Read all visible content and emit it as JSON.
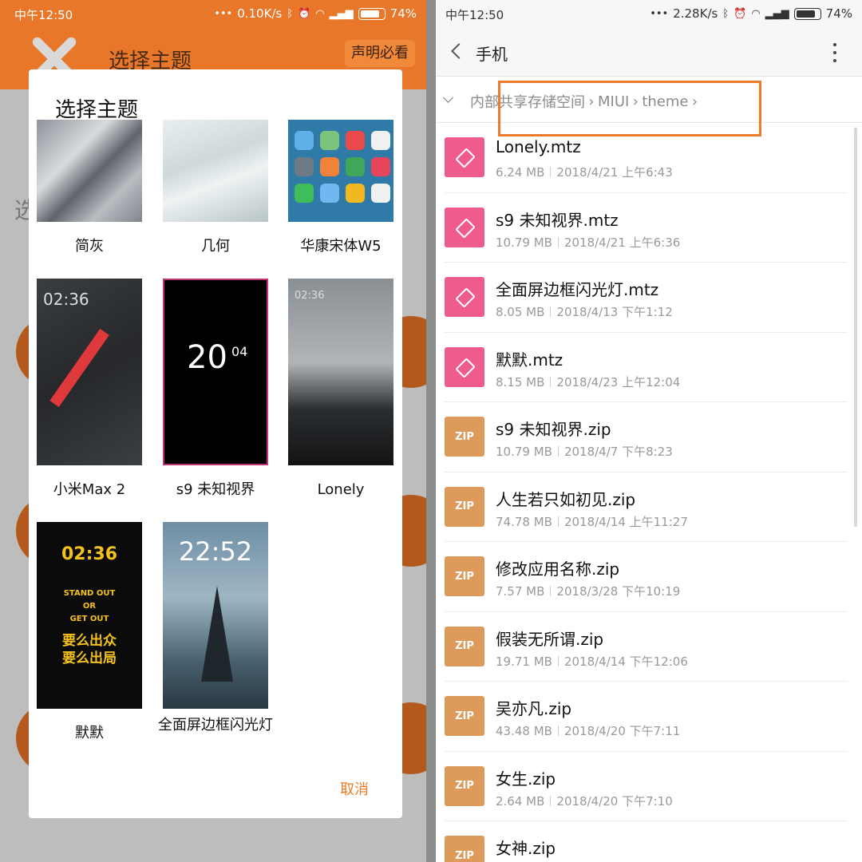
{
  "left": {
    "status": {
      "time": "中午12:50",
      "speed": "0.10K/s",
      "battery": "74%"
    },
    "app": {
      "title": "选择主题",
      "notice_button": "声明必看",
      "bg_char": "选"
    },
    "dialog": {
      "title": "选择主题",
      "themes": [
        {
          "label": "简灰"
        },
        {
          "label": "几何"
        },
        {
          "label": "华康宋体W5"
        },
        {
          "label": "小米Max 2",
          "clock": "02:36"
        },
        {
          "label": "s9 未知视界",
          "clock_hour": "20",
          "clock_min": "04"
        },
        {
          "label": "Lonely",
          "clock": "02:36"
        },
        {
          "label": "默默",
          "clock": "02:36",
          "lines": [
            "STAND OUT",
            "OR",
            "GET OUT",
            "要么出众",
            "要么出局"
          ]
        },
        {
          "label": "全面屏边框闪光灯",
          "clock": "22:52"
        }
      ],
      "cancel": "取消"
    }
  },
  "right": {
    "status": {
      "time": "中午12:50",
      "speed": "2.28K/s",
      "battery": "74%"
    },
    "toolbar": {
      "title": "手机"
    },
    "breadcrumb": [
      "内部共享存储空间",
      "MIUI",
      "theme"
    ],
    "files": [
      {
        "name": "Lonely.mtz",
        "size": "6.24 MB",
        "date": "2018/4/21 上午6:43",
        "type": "mtz"
      },
      {
        "name": "s9  未知视界.mtz",
        "size": "10.79 MB",
        "date": "2018/4/21 上午6:36",
        "type": "mtz"
      },
      {
        "name": "全面屏边框闪光灯.mtz",
        "size": "8.05 MB",
        "date": "2018/4/13 下午1:12",
        "type": "mtz"
      },
      {
        "name": "默默.mtz",
        "size": "8.15 MB",
        "date": "2018/4/23 上午12:04",
        "type": "mtz"
      },
      {
        "name": "s9  未知视界.zip",
        "size": "10.79 MB",
        "date": "2018/4/7 下午8:23",
        "type": "zip"
      },
      {
        "name": "人生若只如初见.zip",
        "size": "74.78 MB",
        "date": "2018/4/14 上午11:27",
        "type": "zip"
      },
      {
        "name": "修改应用名称.zip",
        "size": "7.57 MB",
        "date": "2018/3/28 下午10:19",
        "type": "zip"
      },
      {
        "name": "假装无所谓.zip",
        "size": "19.71 MB",
        "date": "2018/4/14 下午12:06",
        "type": "zip"
      },
      {
        "name": "吴亦凡.zip",
        "size": "43.48 MB",
        "date": "2018/4/20 下午7:11",
        "type": "zip"
      },
      {
        "name": "女生.zip",
        "size": "2.64 MB",
        "date": "2018/4/20 下午7:10",
        "type": "zip"
      },
      {
        "name": "女神.zip",
        "size": "",
        "date": "",
        "type": "zip"
      }
    ],
    "zip_icon_text": "ZIP"
  }
}
